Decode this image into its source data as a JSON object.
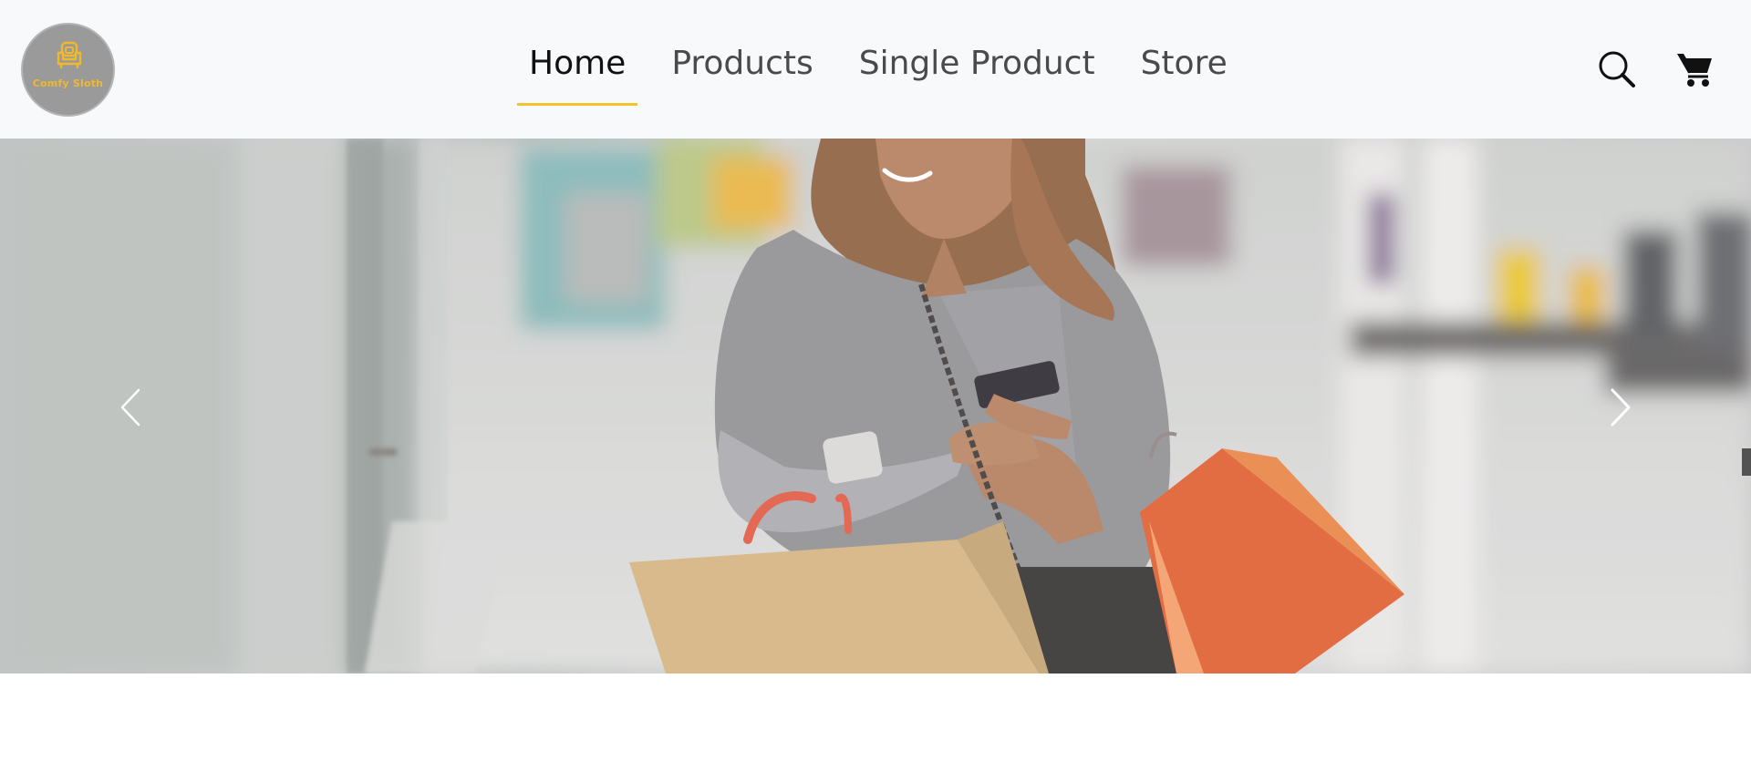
{
  "brand": {
    "logo_text": "Comfy Sloth",
    "accent_color": "#f2c230",
    "logo_bg_color": "#9b9a9b"
  },
  "nav": {
    "links": [
      {
        "label": "Home",
        "active": true
      },
      {
        "label": "Products",
        "active": false
      },
      {
        "label": "Single Product",
        "active": false
      },
      {
        "label": "Store",
        "active": false
      }
    ],
    "icons": [
      "search-icon",
      "cart-icon"
    ]
  },
  "hero": {
    "image": "woman-shopping-bags-phone",
    "controls": [
      "chevron-left-icon",
      "chevron-right-icon"
    ]
  }
}
